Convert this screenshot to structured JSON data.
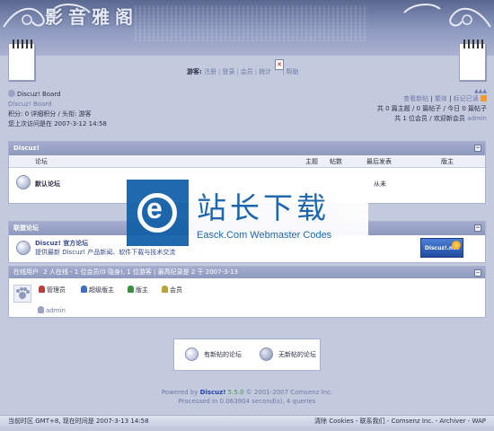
{
  "header": {
    "site_title": "影音雅阁"
  },
  "top_nav": {
    "guest_label": "游客:",
    "items": [
      "注册",
      "登录",
      "会员",
      "统计",
      "帮助"
    ],
    "popup_icon_glyph": "✕"
  },
  "info": {
    "board_title": "Discuz! Board",
    "board_subtitle": "Discuz! Board",
    "credits_line": "积分: 0 详细积分 / 头衔: 游客",
    "last_visit_line": "您上次访问是在 2007-3-12 14:58",
    "right_links": [
      "查看新帖",
      "|",
      "繁体",
      "|",
      "标记已读"
    ],
    "stats_line": "共 0 篇主题 / 0 篇帖子 / 今日 0 篇帖子",
    "members_line": "共 1 位会员 / 欢迎新会员",
    "new_member": "admin"
  },
  "forum_box": {
    "title": "Discuz!",
    "col_forum": "论坛",
    "col_topics": "主题",
    "col_posts": "帖数",
    "col_lastpost": "最后发表",
    "col_moderator": "版主",
    "forums": [
      {
        "name": "默认论坛",
        "last_post": "从未"
      }
    ]
  },
  "links_box": {
    "title": "联盟论坛",
    "link_title": "Discuz! 官方论坛",
    "link_desc": "提供最新 Discuz! 产品新闻、软件下载与技术交流",
    "logo_text": "Discuz!.net"
  },
  "online_box": {
    "title": "在线用户",
    "stats": "2 人在线 - 1 位会员(0 隐身), 1 位游客 | 最高纪录是 2 于 2007-3-13",
    "roles": [
      {
        "label": "管理员",
        "color": "#c23a3a"
      },
      {
        "label": "超级版主",
        "color": "#3f6ec2"
      },
      {
        "label": "版主",
        "color": "#3a8f3a"
      },
      {
        "label": "会员",
        "color": "#b8a23a"
      }
    ],
    "user": "admin"
  },
  "legend": {
    "new_posts": "有新帖的论坛",
    "no_new_posts": "无新帖的论坛"
  },
  "powered": {
    "prefix": "Powered by",
    "brand": "Discuz!",
    "version": "5.5.0",
    "copyright": "© 2001-2007 Comsenz Inc.",
    "processed": "Processed in 0.063804 second(s), 4 queries"
  },
  "footer": {
    "left": "当前时区 GMT+8, 现在时间是 2007-3-13 14:58",
    "right": "清除 Cookies - 联系我们 - Comsenz Inc. - Archiver - WAP"
  },
  "watermark": {
    "cn": "站长下载",
    "en": "Easck.Com Webmaster Codes",
    "logo_letter": "e"
  }
}
